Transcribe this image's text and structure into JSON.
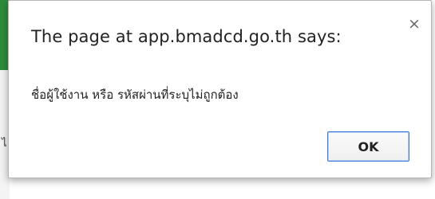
{
  "dialog": {
    "title": "The page at app.bmadcd.go.th says:",
    "message": "ชื่อผู้ใช้งาน หรือ รหัสผ่านที่ระบุไม่ถูกต้อง",
    "ok_label": "OK",
    "close_glyph": "×"
  },
  "background": {
    "partial_glyph": "ไ"
  },
  "colors": {
    "focus_border": "#3f78d6",
    "background_strip": "#2e8b3a"
  }
}
